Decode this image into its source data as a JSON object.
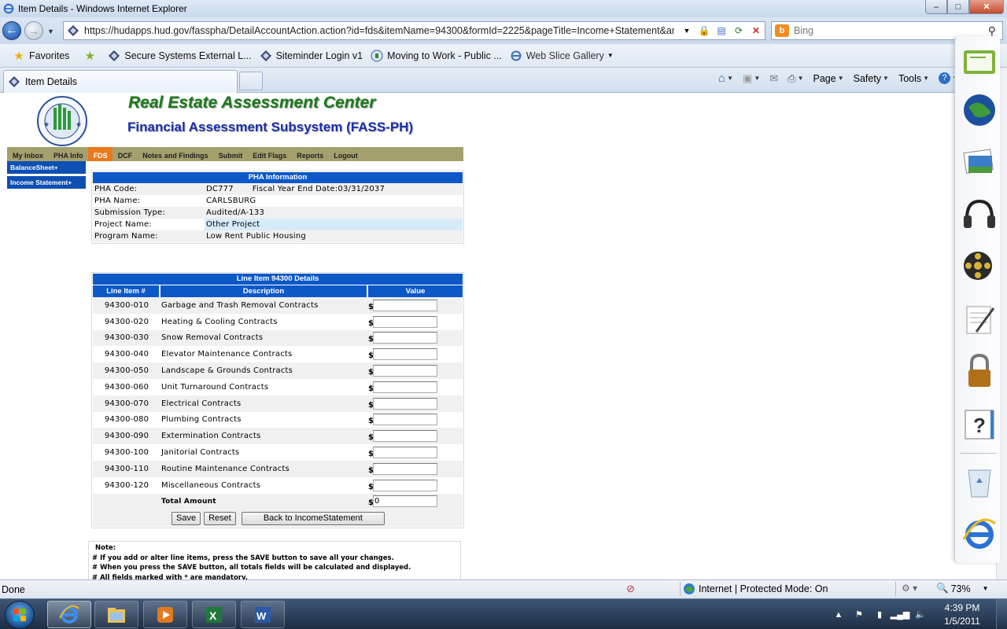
{
  "window": {
    "title": "Item Details - Windows Internet Explorer"
  },
  "address_bar": {
    "url": "https://hudapps.hud.gov/fasspha/DetailAccountAction.action?id=fds&itemName=94300&formId=2225&pageTitle=Income+Statement&am",
    "search_placeholder": "Bing"
  },
  "favorites_bar": {
    "favorites_label": "Favorites",
    "links": [
      {
        "label": "Secure Systems External L...",
        "icon": "hud-icon"
      },
      {
        "label": "Siteminder Login v1",
        "icon": "hud-icon"
      },
      {
        "label": "Moving to Work - Public ...",
        "icon": "hud-seal-icon"
      },
      {
        "label": "Web Slice Gallery",
        "icon": "ie-icon"
      }
    ]
  },
  "tabs": [
    {
      "label": "Item Details"
    }
  ],
  "command_bar": {
    "page": "Page",
    "safety": "Safety",
    "tools": "Tools"
  },
  "app": {
    "title": "Real Estate Assessment Center",
    "subtitle": "Financial Assessment Subsystem (FASS-PH)",
    "menu": [
      "My Inbox",
      "PHA Info",
      "FDS",
      "DCF",
      "Notes and Findings",
      "Submit",
      "Edit Flags",
      "Reports",
      "Logout"
    ],
    "active_menu": "FDS",
    "sidebar_links": [
      "BalanceSheet+",
      "Income Statement+"
    ]
  },
  "pha_info": {
    "header": "PHA Information",
    "rows": [
      {
        "label": "PHA Code:",
        "value": "DC777",
        "extra": "Fiscal Year End Date:03/31/2037"
      },
      {
        "label": "PHA Name:",
        "value": "CARLSBURG"
      },
      {
        "label": "Submission Type:",
        "value": "Audited/A-133"
      },
      {
        "label": "Project Name:",
        "value": "Other Project"
      },
      {
        "label": "Program Name:",
        "value": "Low Rent Public Housing"
      }
    ]
  },
  "line_items": {
    "header": "Line Item 94300 Details",
    "columns": [
      "Line Item #",
      "Description",
      "Value"
    ],
    "currency": "$",
    "rows": [
      {
        "code": "94300-010",
        "description": "Garbage and Trash Removal Contracts",
        "value": ""
      },
      {
        "code": "94300-020",
        "description": "Heating & Cooling Contracts",
        "value": ""
      },
      {
        "code": "94300-030",
        "description": "Snow Removal Contracts",
        "value": ""
      },
      {
        "code": "94300-040",
        "description": "Elevator Maintenance Contracts",
        "value": ""
      },
      {
        "code": "94300-050",
        "description": "Landscape & Grounds Contracts",
        "value": ""
      },
      {
        "code": "94300-060",
        "description": "Unit Turnaround Contracts",
        "value": ""
      },
      {
        "code": "94300-070",
        "description": "Electrical Contracts",
        "value": ""
      },
      {
        "code": "94300-080",
        "description": "Plumbing Contracts",
        "value": ""
      },
      {
        "code": "94300-090",
        "description": "Extermination Contracts",
        "value": ""
      },
      {
        "code": "94300-100",
        "description": "Janitorial Contracts",
        "value": ""
      },
      {
        "code": "94300-110",
        "description": "Routine Maintenance Contracts",
        "value": ""
      },
      {
        "code": "94300-120",
        "description": "Miscellaneous Contracts",
        "value": ""
      }
    ],
    "total_label": "Total Amount",
    "total_value": "0",
    "buttons": {
      "save": "Save",
      "reset": "Reset",
      "back": "Back to IncomeStatement"
    }
  },
  "notes": {
    "title": "Note:",
    "lines": [
      "# If you add or alter line items, press the SAVE button to save all your changes.",
      "# When you press the SAVE button, all totals fields will be calculated and displayed.",
      "# All fields marked with * are mandatory."
    ]
  },
  "status_bar": {
    "status": "Done",
    "zone": "Internet | Protected Mode: On",
    "zoom": "73%"
  },
  "taskbar": {
    "apps": [
      "internet-explorer",
      "windows-explorer",
      "media-player",
      "excel",
      "word"
    ],
    "time": "4:39 PM",
    "date": "1/5/2011"
  },
  "gadgets": [
    "notes-gadget",
    "globe-gadget",
    "photos-gadget",
    "headphones-gadget",
    "film-reel-gadget",
    "notepad-gadget",
    "lock-gadget",
    "help-gadget",
    "recycle-bin-gadget",
    "ie-gadget"
  ],
  "colors": {
    "menu_bar": "#a3a06e",
    "menu_active": "#e8791d",
    "panel_header": "#0d58c7",
    "title_green": "#1b7a1b",
    "subtitle_blue": "#1b2fa6"
  }
}
